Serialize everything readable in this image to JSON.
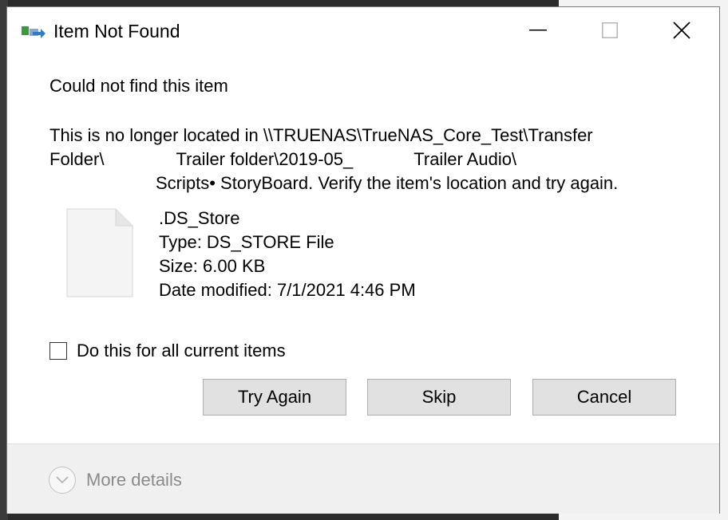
{
  "dialog": {
    "title": "Item Not Found",
    "heading": "Could not find this item",
    "message": {
      "line1": "This is no longer located in \\\\TRUENAS\\TrueNAS_Core_Test\\Transfer",
      "line2_a": "Folder\\",
      "line2_b": "Trailer folder\\2019-05_",
      "line2_c": "Trailer Audio\\",
      "line3": "Scripts• StoryBoard. Verify the item's location and try again."
    },
    "file": {
      "name": ".DS_Store",
      "type": "Type: DS_STORE File",
      "size": "Size: 6.00 KB",
      "date_modified": "Date modified: 7/1/2021 4:46 PM"
    },
    "checkbox_label": "Do this for all current items",
    "checkbox_checked": false,
    "buttons": {
      "try_again": "Try Again",
      "skip": "Skip",
      "cancel": "Cancel"
    },
    "more_details": "More details"
  }
}
